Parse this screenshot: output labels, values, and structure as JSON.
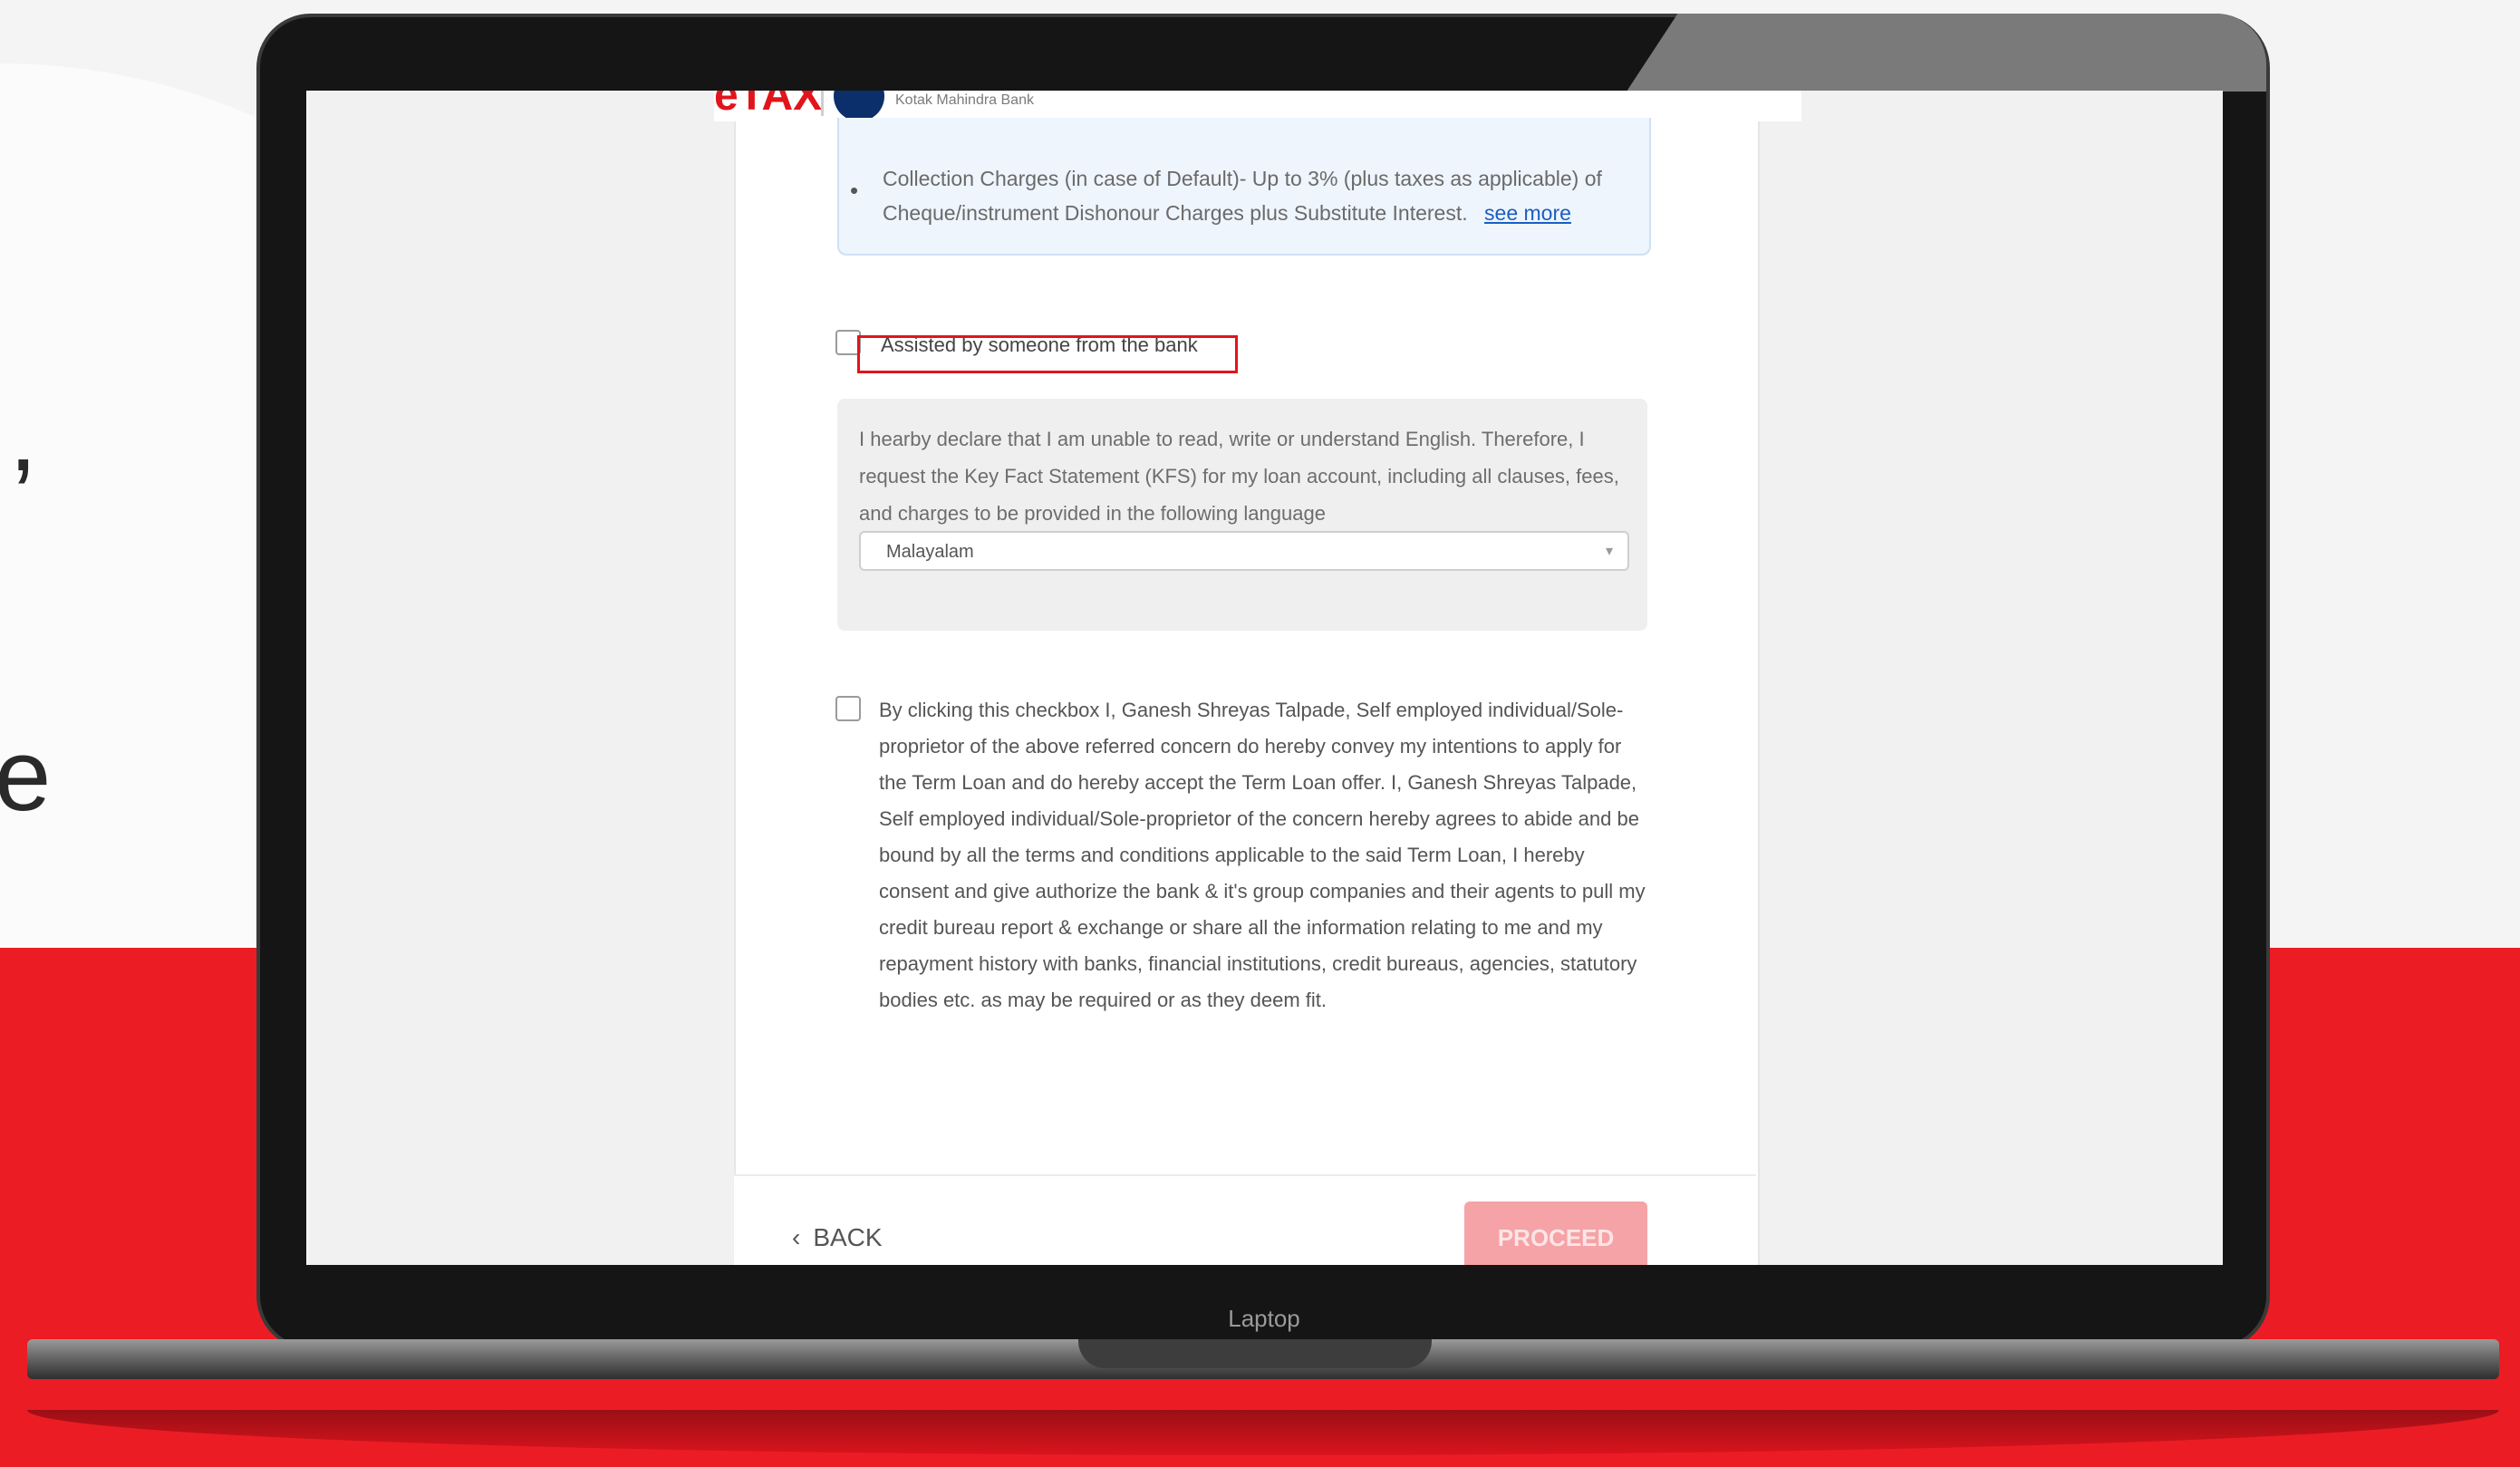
{
  "background": {
    "accent_red": "#ec1c24",
    "side_glyph_comma": ",",
    "side_glyph_e": "e"
  },
  "laptop": {
    "label": "Laptop"
  },
  "header": {
    "brand": "eTAX",
    "bank_name": "Kotak Mahindra Bank"
  },
  "charges": {
    "bullet": "•",
    "collection_text": "Collection Charges (in case of Default)- Up to 3% (plus taxes as applicable) of Cheque/instrument Dishonour Charges plus Substitute Interest.",
    "see_more": "see more"
  },
  "assisted": {
    "label": "Assisted by someone from the bank",
    "checked": false
  },
  "declaration": {
    "text": "I hearby declare that I am unable to read, write or understand English. Therefore, I request the Key Fact Statement (KFS) for my loan account, including all clauses, fees, and charges to be provided in the following language",
    "language_selected": "Malayalam",
    "caret": "▾"
  },
  "consent": {
    "checked": false,
    "text": "By clicking this checkbox I, Ganesh Shreyas Talpade, Self employed individual/Sole-proprietor of the above referred concern do hereby convey my intentions to apply for the Term Loan and do hereby accept the Term Loan offer. I, Ganesh Shreyas Talpade, Self employed individual/Sole-proprietor of the concern hereby agrees to abide and be bound by all the terms and conditions applicable to the said Term Loan, I hereby consent and give authorize the bank & it's group companies and their agents to pull my credit bureau report & exchange or share all the information relating to me and my repayment history with banks, financial institutions, credit bureaus, agencies, statutory bodies etc. as may be required or as they deem fit."
  },
  "footer": {
    "back_chevron": "‹",
    "back_label": "BACK",
    "proceed_label": "PROCEED"
  }
}
